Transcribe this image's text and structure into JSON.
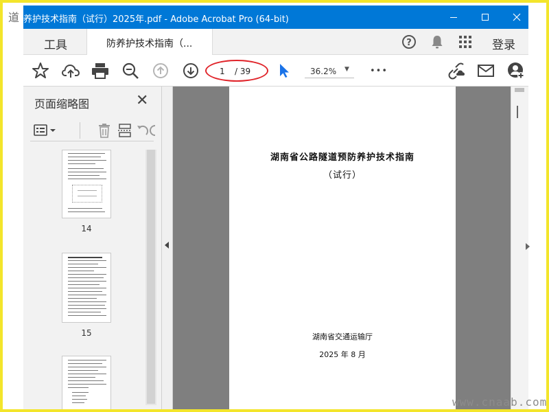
{
  "window": {
    "title": "养护技术指南（试行）2025年.pdf - Adobe Acrobat Pro (64-bit)",
    "minimize_icon": "minimize-icon",
    "maximize_icon": "maximize-icon",
    "close_icon": "close-icon"
  },
  "menubar": {
    "tools_label": "工具",
    "doc_tab_label": "防养护技术指南（...",
    "help_icon": "help-icon",
    "bell_icon": "bell-icon",
    "apps_icon": "apps-grid-icon",
    "login_label": "登录"
  },
  "toolbar": {
    "current_page": "1",
    "total_pages": "/ 39",
    "zoom_value": "36.2%",
    "more_label": "•••"
  },
  "left_panel": {
    "title": "页面缩略图",
    "close_label": "✕",
    "thumbnails": [
      {
        "page_label": "14"
      },
      {
        "page_label": "15"
      },
      {
        "page_label": ""
      }
    ]
  },
  "document": {
    "title": "湖南省公路隧道预防养护技术指南",
    "subtitle": "（试行）",
    "issuer": "湖南省交通运输厅",
    "date": "2025 年 8 月"
  },
  "decorations": {
    "logo_text": "道",
    "watermark": "www.cnaab.com"
  },
  "colors": {
    "titlebar": "#0078d7",
    "annotation": "#e0242a",
    "frame": "#f3e52b",
    "cursor": "#1a73e8"
  }
}
